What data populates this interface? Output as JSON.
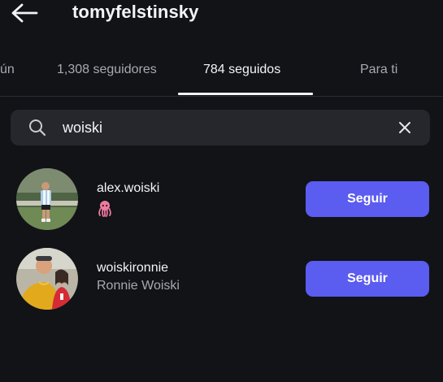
{
  "header": {
    "username": "tomyfelstinsky",
    "back_icon": "arrow-left-icon"
  },
  "tabs": [
    {
      "label": "ún",
      "active": false
    },
    {
      "label": "1,308 seguidores",
      "active": false
    },
    {
      "label": "784 seguidos",
      "active": true
    },
    {
      "label": "Para ti",
      "active": false
    }
  ],
  "search": {
    "value": "woiski",
    "icon": "search-icon",
    "clear_icon": "close-icon"
  },
  "results": [
    {
      "handle": "alex.woiski",
      "subtitle": "",
      "emoji": "octopus-icon",
      "button_label": "Seguir"
    },
    {
      "handle": "woiskironnie",
      "subtitle": "Ronnie Woiski",
      "button_label": "Seguir"
    }
  ],
  "colors": {
    "background": "#121317",
    "search_bg": "#25272d",
    "follow_button": "#5b5cf0",
    "muted_text": "#a7a9b1"
  }
}
